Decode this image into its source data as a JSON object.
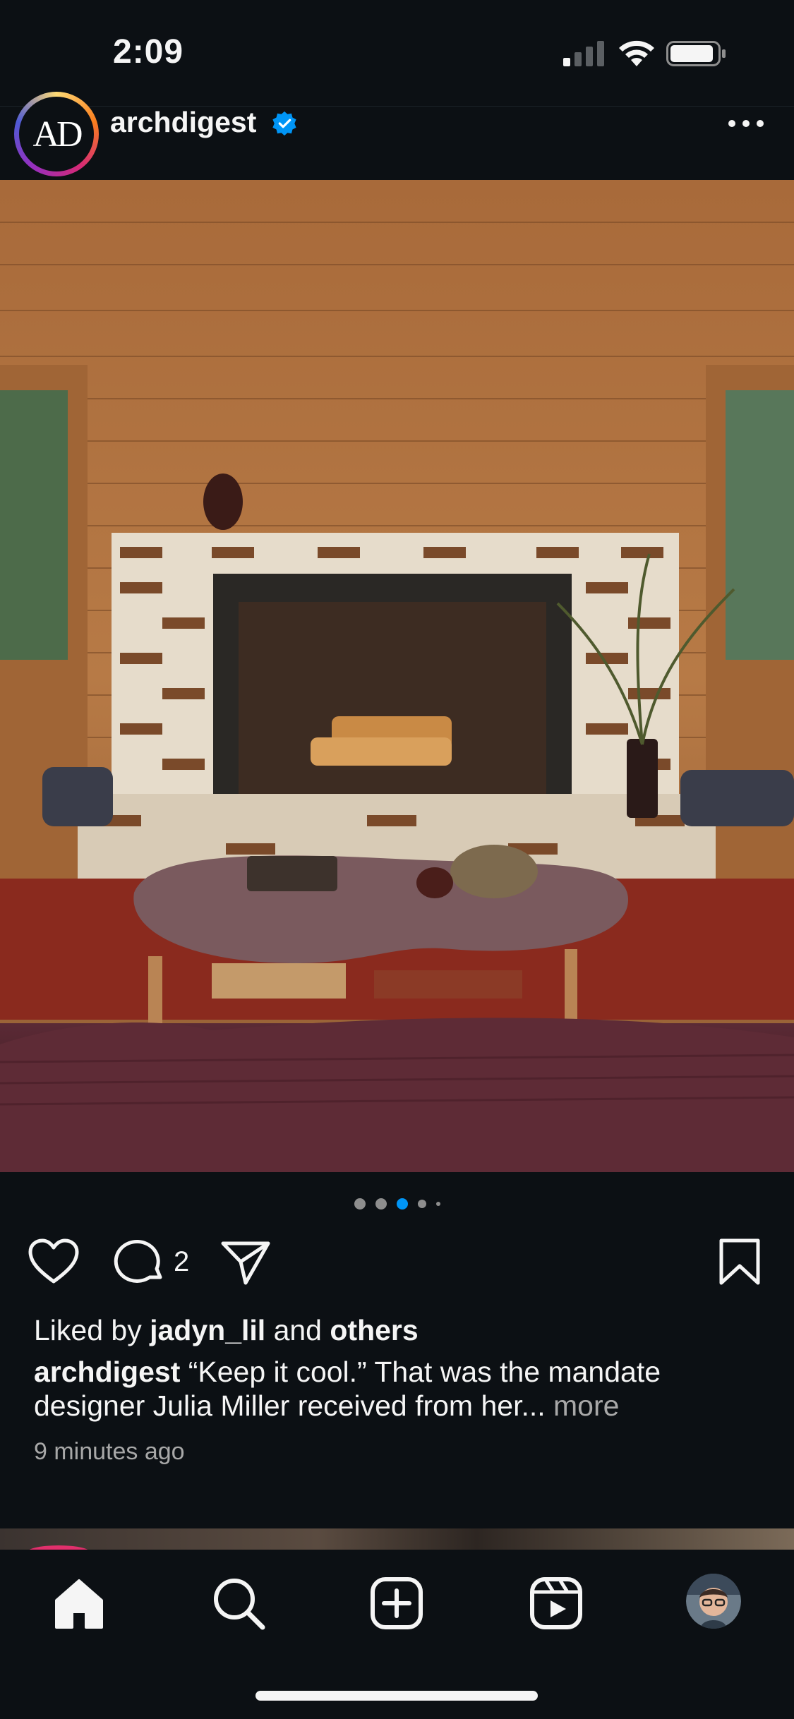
{
  "status_bar": {
    "time": "2:09"
  },
  "post": {
    "avatar_text": "AD",
    "username": "archdigest",
    "verified_icon": "verified-badge-icon",
    "comment_count": "2",
    "carousel": {
      "total": 5,
      "active_index": 2
    },
    "likes": {
      "prefix": "Liked by ",
      "user": "jadyn_lil",
      "middle": " and ",
      "others": "others"
    },
    "caption": {
      "username": "archdigest",
      "text": "“Keep it cool.” That was the mandate designer Julia Miller received from her...",
      "more": " more"
    },
    "timestamp": "9 minutes ago"
  },
  "tab_bar": {
    "items": [
      "home-icon",
      "search-icon",
      "create-icon",
      "reels-icon",
      "profile-avatar"
    ]
  },
  "colors": {
    "background": "#0c1014",
    "accent_blue": "#0095f6",
    "muted_text": "#a8a8a8"
  }
}
